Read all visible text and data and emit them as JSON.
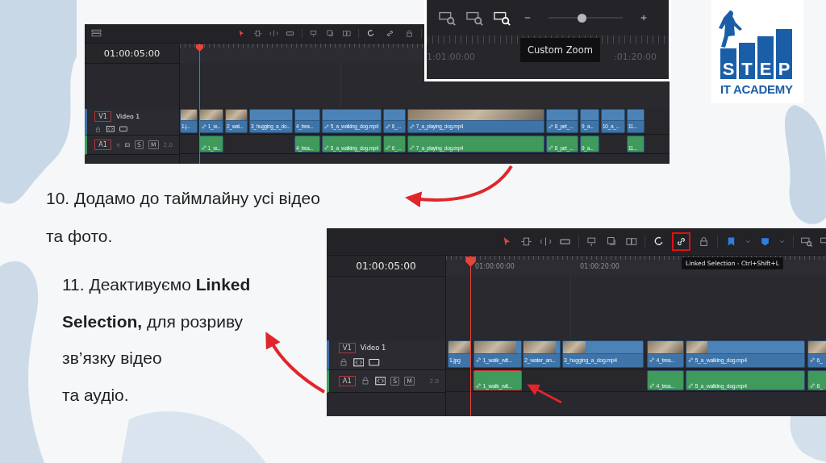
{
  "timelines": [
    {
      "toolbar": {
        "linked_selection_highlighted": false
      },
      "timecode": "01:00:05:00",
      "tracks": [
        {
          "kind": "video",
          "badge": "V1",
          "name": "Video 1",
          "clips": [
            {
              "label": "1.j...",
              "linked": false,
              "thumbnail": true,
              "selected": false
            },
            {
              "label": "1_w...",
              "linked": true,
              "thumbnail": true,
              "selected": false
            },
            {
              "label": "2_wat...",
              "linked": false,
              "thumbnail": true,
              "selected": false
            },
            {
              "label": "3_hugging_a_do...",
              "linked": false,
              "thumbnail": false,
              "selected": false
            },
            {
              "label": "4_trea...",
              "linked": false,
              "thumbnail": false,
              "selected": false
            },
            {
              "label": "5_a_walking_dog.mp4",
              "linked": true,
              "thumbnail": false,
              "selected": false
            },
            {
              "label": "6_...",
              "linked": true,
              "thumbnail": false,
              "selected": false
            },
            {
              "label": "7_a_playing_dog.mp4",
              "linked": true,
              "thumbnail": true,
              "selected": false
            },
            {
              "label": "8_pet_...",
              "linked": true,
              "thumbnail": false,
              "selected": false
            },
            {
              "label": "9_a...",
              "linked": false,
              "thumbnail": false,
              "selected": false
            },
            {
              "label": "10_a_...",
              "linked": false,
              "thumbnail": false,
              "selected": false
            },
            {
              "label": "11...",
              "linked": false,
              "thumbnail": false,
              "selected": false
            }
          ]
        },
        {
          "kind": "audio",
          "badge": "A1",
          "solo": "S",
          "mute": "M",
          "channels": "2.0",
          "clips": [
            {
              "label": "1_w...",
              "linked": true,
              "selected": false
            },
            {
              "label": "4_trea...",
              "linked": false,
              "selected": false
            },
            {
              "label": "5_a_walking_dog.mp4",
              "linked": true,
              "selected": false
            },
            {
              "label": "6_...",
              "linked": true,
              "selected": false
            },
            {
              "label": "7_a_playing_dog.mp4",
              "linked": true,
              "selected": false
            },
            {
              "label": "8_pet_...",
              "linked": true,
              "selected": false
            },
            {
              "label": "9_a...",
              "linked": false,
              "selected": false
            },
            {
              "label": "11...",
              "linked": false,
              "selected": false
            }
          ]
        }
      ]
    },
    {
      "toolbar": {
        "linked_selection_highlighted": true
      },
      "tooltip": "Linked Selection - Ctrl+Shift+L",
      "timecode": "01:00:05:00",
      "ruler_labels": [
        "01:00:00:00",
        "01:00:20:00"
      ],
      "tracks": [
        {
          "kind": "video",
          "badge": "V1",
          "name": "Video 1",
          "clips": [
            {
              "label": "1.jpg",
              "linked": false,
              "thumbnail": true,
              "selected": false
            },
            {
              "label": "1_walk_wit...",
              "linked": true,
              "thumbnail": true,
              "selected": false
            },
            {
              "label": "2_water_an...",
              "linked": false,
              "thumbnail": true,
              "selected": false
            },
            {
              "label": "3_hugging_a_dog.mp4",
              "linked": false,
              "thumbnail": true,
              "selected": false
            },
            {
              "label": "4_trea...",
              "linked": true,
              "thumbnail": true,
              "selected": false
            },
            {
              "label": "5_a_walking_dog.mp4",
              "linked": true,
              "thumbnail": true,
              "selected": false
            },
            {
              "label": "6_",
              "linked": true,
              "thumbnail": true,
              "selected": false
            }
          ]
        },
        {
          "kind": "audio",
          "badge": "A1",
          "solo": "S",
          "mute": "M",
          "channels": "2.0",
          "clips": [
            {
              "label": "1_walk_wit...",
              "linked": true,
              "selected": true
            },
            {
              "label": "4_trea...",
              "linked": true,
              "selected": false
            },
            {
              "label": "5_a_walking_dog.mp4",
              "linked": true,
              "selected": false
            },
            {
              "label": "6_",
              "linked": true,
              "selected": false
            }
          ]
        }
      ]
    }
  ],
  "zoom_inset": {
    "level": 0.45,
    "tooltip": "Custom Zoom",
    "ruler_labels": [
      "1:01:00:00",
      ":01:20:00"
    ]
  },
  "steps": [
    "10. Додамо до таймлайну усі відео\nта фото.",
    "11. Деактивуємо **Linked**\n**Selection,** для розриву\nзв’язку відео\nта аудіо."
  ],
  "logo": {
    "letters": [
      "S",
      "T",
      "E",
      "P"
    ],
    "subtitle": "IT ACADEMY"
  }
}
